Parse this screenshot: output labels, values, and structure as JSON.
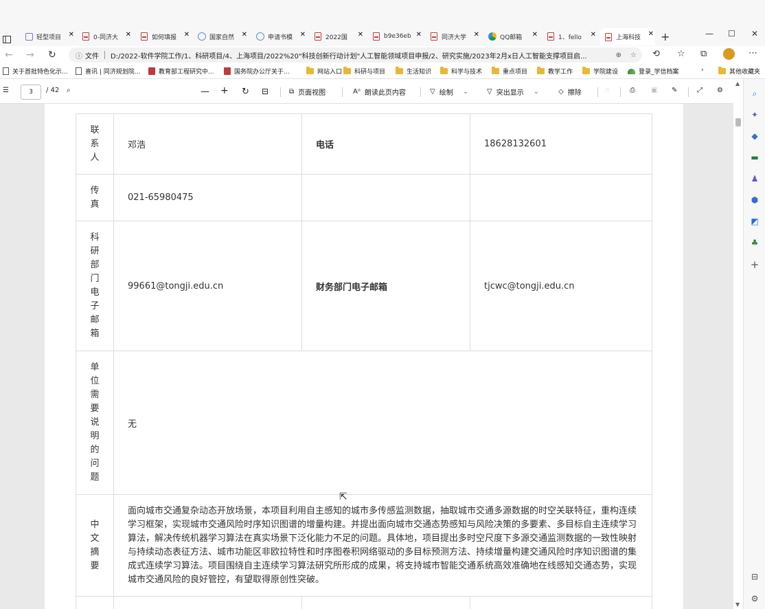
{
  "tabs": [
    {
      "title": "轻型项目",
      "icon": "purple"
    },
    {
      "title": "0-同济大",
      "icon": "pdf"
    },
    {
      "title": "如何填报",
      "icon": "pdf"
    },
    {
      "title": "国家自然",
      "icon": "globe"
    },
    {
      "title": "申请书模",
      "icon": "globe"
    },
    {
      "title": "2022国",
      "icon": "pdf"
    },
    {
      "title": "b9e36eb",
      "icon": "pdf"
    },
    {
      "title": "同济大学",
      "icon": "pdf"
    },
    {
      "title": "QQ邮箱",
      "icon": "qq"
    },
    {
      "title": "1、fello",
      "icon": "pdf"
    },
    {
      "title": "上海科技",
      "icon": "pdf",
      "active": true
    }
  ],
  "address": {
    "info_label": "文件",
    "url": "D:/2022-软件学院工作/1、科研项目/4、上海项目/2022%20\"科技创新行动计划\"人工智能领域项目申报/2、研究实施/2023年2月x日人工智能支撑项目启..."
  },
  "bookmarks": [
    {
      "label": "关于首批特色化示...",
      "icon": "doc"
    },
    {
      "label": "喜讯 | 同济规划院...",
      "icon": "doc"
    },
    {
      "label": "教育部工程研究中...",
      "icon": "pdf"
    },
    {
      "label": "国务院办公厅关于...",
      "icon": "pdf"
    },
    {
      "label": "网站入口",
      "icon": "folder"
    },
    {
      "label": "科研与项目",
      "icon": "folder"
    },
    {
      "label": "生活知识",
      "icon": "folder"
    },
    {
      "label": "科学与技术",
      "icon": "folder"
    },
    {
      "label": "重点项目",
      "icon": "folder"
    },
    {
      "label": "教学工作",
      "icon": "folder"
    },
    {
      "label": "学院建设",
      "icon": "folder"
    },
    {
      "label": "登录_学信档案",
      "icon": "edge"
    }
  ],
  "bookmarks_other": "其他收藏夹",
  "pdf_toolbar": {
    "page_current": "3",
    "page_total": "/ 42",
    "page_view": "页面视图",
    "read_aloud": "朗读此页内容",
    "draw": "绘制",
    "highlight": "突出显示",
    "erase": "擦除"
  },
  "form": {
    "contact_label": "联系人",
    "contact_value": "邓浩",
    "phone_label": "电话",
    "phone_value": "18628132601",
    "fax_label": "传真",
    "fax_value": "021-65980475",
    "research_email_label": "科研部门电子邮箱",
    "research_email_value": "99661@tongji.edu.cn",
    "finance_email_label": "财务部门电子邮箱",
    "finance_email_value": "tjcwc@tongji.edu.cn",
    "notes_label": "单位需要说明的问题",
    "notes_value": "无",
    "abstract_label": "中文摘要",
    "abstract_value": "面向城市交通复杂动态开放场景，本项目利用自主感知的城市多传感监测数据，抽取城市交通多源数据的时空关联特征，重构连续学习框架，实现城市交通风险时序知识图谱的增量构建。并提出面向城市交通态势感知与风险决策的多要素、多目标自主连续学习算法，解决传统机器学习算法在真实场景下泛化能力不足的问题。具体地，项目提出多时空尺度下多源交通监测数据的一致性映射与持续动态表征方法、城市功能区非欧拉特性和时序图卷积网络驱动的多目标预测方法、持续增量构建交通风险时序知识图谱的集成式连续学习算法。项目围绕自主连续学习算法研究所形成的成果，将支持城市智能交通系统高效准确地在线感知交通态势，实现城市交通风险的良好管控，有望取得原创性突破。"
  }
}
